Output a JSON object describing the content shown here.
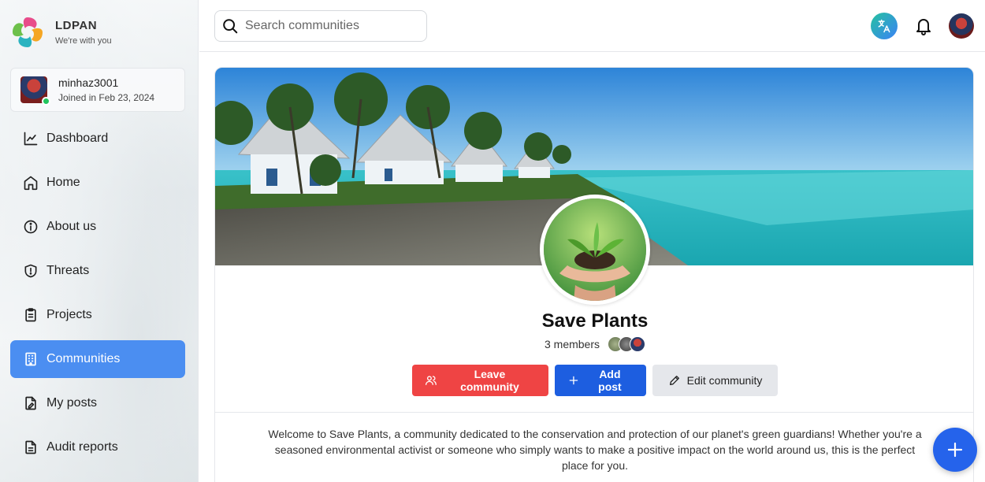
{
  "brand": {
    "name": "LDPAN",
    "tagline": "We're with you",
    "logo_icon": "leaf-swirl-logo"
  },
  "user": {
    "name": "minhaz3001",
    "joined": "Joined in Feb 23, 2024",
    "status": "online"
  },
  "nav": {
    "items": [
      {
        "label": "Dashboard",
        "icon": "chart-line-icon",
        "active": false
      },
      {
        "label": "Home",
        "icon": "home-icon",
        "active": false
      },
      {
        "label": "About us",
        "icon": "info-icon",
        "active": false
      },
      {
        "label": "Threats",
        "icon": "shield-icon",
        "active": false
      },
      {
        "label": "Projects",
        "icon": "clipboard-icon",
        "active": false
      },
      {
        "label": "Communities",
        "icon": "building-icon",
        "active": true
      },
      {
        "label": "My posts",
        "icon": "file-edit-icon",
        "active": false
      },
      {
        "label": "Audit reports",
        "icon": "document-icon",
        "active": false
      }
    ]
  },
  "topbar": {
    "search_placeholder": "Search communities",
    "translate_icon": "translate-icon",
    "notification_icon": "bell-icon"
  },
  "community": {
    "title": "Save Plants",
    "members": "3 members",
    "actions": {
      "leave": "Leave community",
      "add_post": "Add post",
      "edit": "Edit community"
    },
    "description": "Welcome to Save Plants, a community dedicated to the conservation and protection of our planet's green guardians! Whether you're a seasoned environmental activist or someone who simply wants to make a positive impact on the world around us, this is the perfect place for you."
  },
  "colors": {
    "active_nav": "#4b8ef1",
    "leave_button": "#ef4444",
    "add_post_button": "#1d5ee0",
    "edit_button": "#e5e7eb",
    "fab": "#2563eb"
  },
  "fab": {
    "icon": "plus-icon"
  }
}
